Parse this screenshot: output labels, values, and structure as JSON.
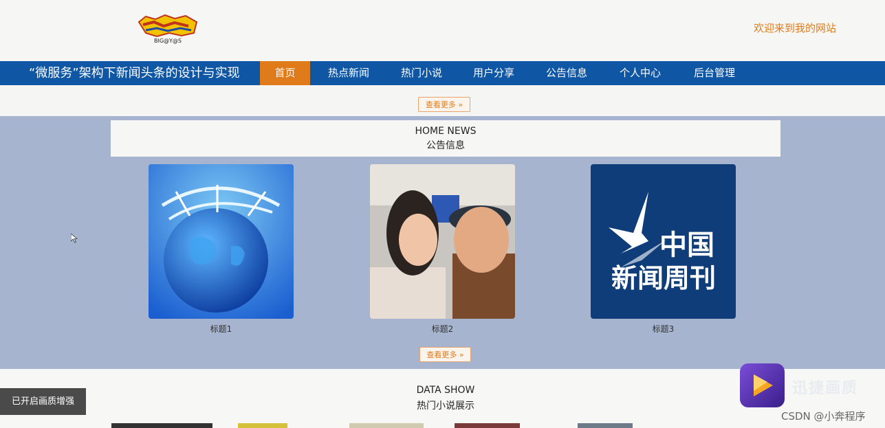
{
  "header": {
    "logo_text": "BIG@Y@S",
    "welcome": "欢迎来到我的网站"
  },
  "nav": {
    "title": "“微服务”架构下新闻头条的设计与实现",
    "items": [
      {
        "label": "首页",
        "active": true
      },
      {
        "label": "热点新闻"
      },
      {
        "label": "热门小说"
      },
      {
        "label": "用户分享"
      },
      {
        "label": "公告信息"
      },
      {
        "label": "个人中心"
      },
      {
        "label": "后台管理"
      }
    ]
  },
  "top_more": "查看更多 »",
  "news_section": {
    "title_en": "HOME NEWS",
    "title_cn": "公告信息",
    "cards": [
      {
        "caption": "标题1",
        "image": "globe-network"
      },
      {
        "caption": "标题2",
        "image": "portrait-couple"
      },
      {
        "caption": "标题3",
        "image": "china-news-weekly-logo",
        "logo_line1": "中国",
        "logo_line2": "新闻周刊"
      }
    ],
    "more": "查看更多 »"
  },
  "data_section": {
    "title_en": "DATA SHOW",
    "title_cn": "热门小说展示"
  },
  "overlay": {
    "toast": "已开启画质增强",
    "watermark": "CSDN @小奔程序",
    "app_name": "迅捷画质"
  },
  "colors": {
    "nav_bg": "#0f57a5",
    "accent": "#e07b1c",
    "band_bg": "#a6b4cf"
  }
}
